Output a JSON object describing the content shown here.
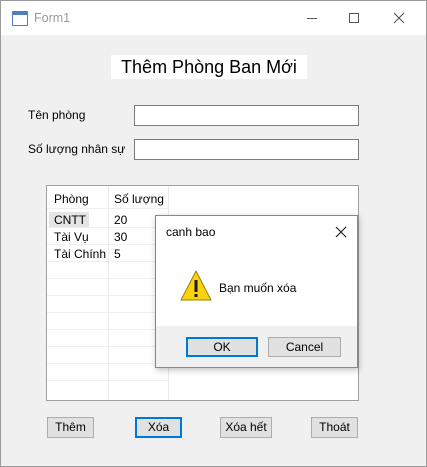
{
  "window": {
    "title": "Form1",
    "icon": "windows-form-icon",
    "controls": [
      "minimize-icon",
      "maximize-icon",
      "close-icon"
    ]
  },
  "form": {
    "heading": "Thêm Phòng Ban Mới",
    "name_label": "Tên phòng",
    "name_value": "",
    "count_label": "Số lượng nhân sự",
    "count_value": ""
  },
  "grid": {
    "columns": [
      "Phòng",
      "Số lượng"
    ],
    "rows": [
      {
        "phong": "CNTT",
        "so_luong": "20"
      },
      {
        "phong": "Tài Vụ",
        "so_luong": "30"
      },
      {
        "phong": "Tài Chính",
        "so_luong": "5"
      }
    ],
    "selected_row": 0
  },
  "buttons": {
    "add": "Thêm",
    "delete": "Xóa",
    "clear": "Xóa hết",
    "exit": "Thoát"
  },
  "dialog": {
    "title": "canh bao",
    "message": "Bạn muốn xóa",
    "icon": "warning-icon",
    "ok": "OK",
    "cancel": "Cancel"
  },
  "colors": {
    "focus_accent": "#0078d7",
    "warning_yellow": "#f8d30e",
    "form_background": "#f0f0f0"
  }
}
